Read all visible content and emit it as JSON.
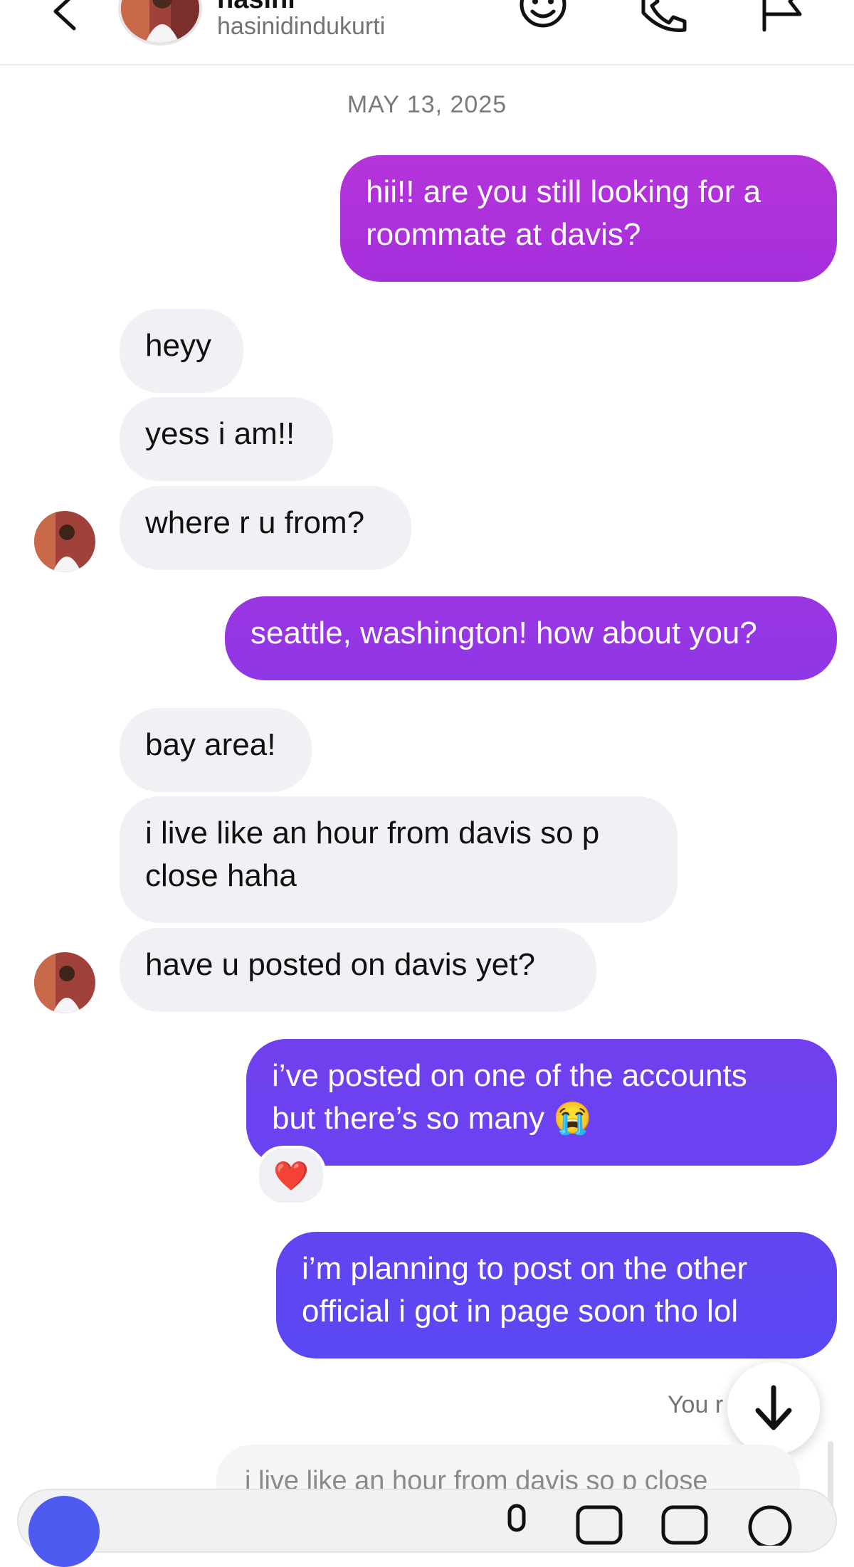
{
  "header": {
    "name": "hasini",
    "username": "hasinidindukurti"
  },
  "conversation": {
    "date_separator": "MAY 13, 2025",
    "messages": [
      {
        "id": "m1",
        "side": "sent",
        "text": "hii!! are you still looking for a\nroommate at davis?"
      },
      {
        "id": "m2",
        "side": "received",
        "text": "heyy"
      },
      {
        "id": "m3",
        "side": "received",
        "text": "yess i am!!"
      },
      {
        "id": "m4",
        "side": "received",
        "text": "where r u from?"
      },
      {
        "id": "m5",
        "side": "sent",
        "text": "seattle, washington! how about you?"
      },
      {
        "id": "m6",
        "side": "received",
        "text": "bay area!"
      },
      {
        "id": "m7",
        "side": "received",
        "text": "i live like an hour from davis so p\nclose haha"
      },
      {
        "id": "m8",
        "side": "received",
        "text": "have u posted on davis yet?"
      },
      {
        "id": "m9",
        "side": "sent",
        "text": "i’ve posted on one of the accounts\nbut there’s so many 😭"
      },
      {
        "id": "m10",
        "side": "sent",
        "text": "i’m planning to post on the other\nofficial i got in page soon tho lol"
      }
    ],
    "reaction": "❤️",
    "seen_label": "You r",
    "reply_preview": "i live like an hour from davis so p close"
  },
  "colors": {
    "sent_gradient_top": "#b02fd8",
    "sent_gradient_bottom": "#5b45f2",
    "received_bg": "#eff1f4",
    "camera_button": "#4f5bf0"
  },
  "icons": [
    "back-icon",
    "sticker-icon",
    "phone-icon",
    "flag-icon",
    "arrow-down-icon",
    "camera-icon",
    "mic-icon",
    "photo-icon",
    "sticker-icon",
    "plus-icon"
  ]
}
